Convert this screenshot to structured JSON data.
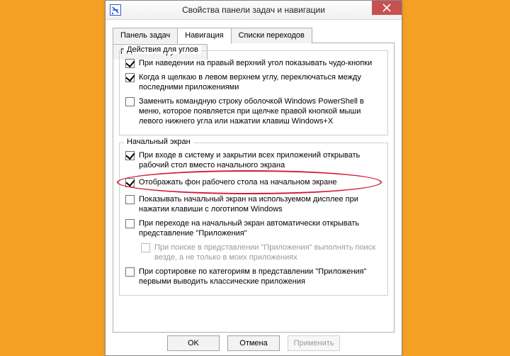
{
  "window": {
    "title": "Свойства панели задач и навигации"
  },
  "tabs": {
    "taskbar": "Панель задач",
    "navigation": "Навигация",
    "jumplists": "Списки переходов",
    "toolbars": "Панели инструментов"
  },
  "group_corners": {
    "title": "Действия для углов",
    "opt1": {
      "checked": true,
      "label": "При наведении на правый верхний угол показывать чудо-кнопки"
    },
    "opt2": {
      "checked": true,
      "label": "Когда я щелкаю в левом верхнем углу, переключаться между последними приложениями"
    },
    "opt3": {
      "checked": false,
      "label": "Заменить командную строку оболочкой Windows PowerShell в меню, которое появляется при щелчке правой кнопкой мыши левого нижнего угла или нажатии клавиш Windows+X"
    }
  },
  "group_start": {
    "title": "Начальный экран",
    "opt1": {
      "checked": true,
      "label": "При входе в систему и закрытии всех приложений открывать рабочий стол вместо начального экрана"
    },
    "opt2": {
      "checked": true,
      "label": "Отображать фон рабочего стола на начальном экране"
    },
    "opt3": {
      "checked": false,
      "label": "Показывать начальный экран на используемом дисплее при нажатии клавиши с логотипом Windows"
    },
    "opt4": {
      "checked": false,
      "label": "При переходе на начальный экран автоматически открывать представление \"Приложения\""
    },
    "opt4a": {
      "checked": false,
      "label": "При поиске в представлении \"Приложения\" выполнять поиск везде, а не только в моих приложениях"
    },
    "opt5": {
      "checked": false,
      "label": "При сортировке по категориям в представлении \"Приложения\" первыми выводить классические приложения"
    }
  },
  "buttons": {
    "ok": "OK",
    "cancel": "Отмена",
    "apply": "Применить"
  }
}
